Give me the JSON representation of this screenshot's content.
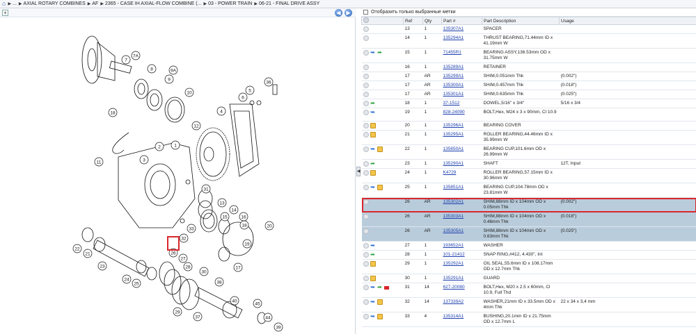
{
  "breadcrumb": {
    "home_icon": "home-icon",
    "items": [
      "...",
      "AXIAL ROTARY COMBINES",
      "AF",
      "2365 - CASE IH AXIAL-FLOW COMBINE (...",
      "03 - POWER TRAIN",
      "06-21 - FINAL DRIVE ASSY"
    ]
  },
  "filter": {
    "label": "Отобразить только выбранные метки",
    "checked": false
  },
  "columns": [
    "",
    "Ref",
    "Qty",
    "Part #",
    "Part Description",
    "Usage"
  ],
  "rows": [
    {
      "ref": "13",
      "qty": "1",
      "part": "135307A1",
      "desc": "SPACER",
      "usage": "",
      "icons": [
        "circle"
      ],
      "state": ""
    },
    {
      "ref": "14",
      "qty": "1",
      "part": "135294A1",
      "desc": "THRUST BEARING,71.44mm ID x 41.19mm W",
      "usage": "",
      "icons": [
        "circle"
      ],
      "state": ""
    },
    {
      "ref": "15",
      "qty": "1",
      "part": "71455R1",
      "desc": "BEARING ASSY,136.53mm OD x 31.75mm W",
      "usage": "",
      "icons": [
        "circle",
        "blue",
        "green"
      ],
      "state": ""
    },
    {
      "ref": "16",
      "qty": "1",
      "part": "135289A1",
      "desc": "RETAINER",
      "usage": "",
      "icons": [
        "circle"
      ],
      "state": ""
    },
    {
      "ref": "17",
      "qty": "AR",
      "part": "135299A1",
      "desc": "SHIM,0.051mm Thk",
      "usage": "(0.002\")",
      "icons": [
        "circle"
      ],
      "state": ""
    },
    {
      "ref": "17",
      "qty": "AR",
      "part": "135300A1",
      "desc": "SHIM,0.457mm Thk",
      "usage": "(0.018\")",
      "icons": [
        "circle"
      ],
      "state": ""
    },
    {
      "ref": "17",
      "qty": "AR",
      "part": "135301A1",
      "desc": "SHIM,0.635mm Thk",
      "usage": "(0.025\")",
      "icons": [
        "circle"
      ],
      "state": ""
    },
    {
      "ref": "18",
      "qty": "1",
      "part": "37-1512",
      "desc": "DOWEL,5/16\" x 3/4\"",
      "usage": "5/16 x 3/4",
      "icons": [
        "circle",
        "green"
      ],
      "state": ""
    },
    {
      "ref": "19",
      "qty": "1",
      "part": "828-24090",
      "desc": "BOLT,Hex, M24 x 3 x 90mm, Cl 10.9",
      "usage": "",
      "icons": [
        "circle",
        "blue"
      ],
      "state": ""
    },
    {
      "ref": "20",
      "qty": "1",
      "part": "135296A1",
      "desc": "BEARING COVER",
      "usage": "",
      "icons": [
        "circle",
        "box"
      ],
      "state": ""
    },
    {
      "ref": "21",
      "qty": "1",
      "part": "135295A1",
      "desc": "ROLLER BEARING,44.46mm ID x 35.99mm W",
      "usage": "",
      "icons": [
        "circle",
        "box"
      ],
      "state": ""
    },
    {
      "ref": "22",
      "qty": "1",
      "part": "135650A1",
      "desc": "BEARING CUP,101.6mm OD x 26.99mm W",
      "usage": "",
      "icons": [
        "circle",
        "blue",
        "box"
      ],
      "state": ""
    },
    {
      "ref": "23",
      "qty": "1",
      "part": "135290A1",
      "desc": "SHAFT",
      "usage": "12T, Input",
      "icons": [
        "circle",
        "green"
      ],
      "state": ""
    },
    {
      "ref": "24",
      "qty": "1",
      "part": "K4729",
      "desc": "ROLLER BEARING,57.15mm ID x 30.96mm W",
      "usage": "",
      "icons": [
        "circle",
        "box"
      ],
      "state": ""
    },
    {
      "ref": "25",
      "qty": "1",
      "part": "135851A1",
      "desc": "BEARING CUP,104.78mm OD x 23.81mm W",
      "usage": "",
      "icons": [
        "circle",
        "blue",
        "box"
      ],
      "state": ""
    },
    {
      "ref": "26",
      "qty": "AR",
      "part": "135302A1",
      "desc": "SHIM,88mm ID x 104mm OD x 0.05mm Thk",
      "usage": "(0.002\")",
      "icons": [
        "circle"
      ],
      "state": "highlight"
    },
    {
      "ref": "26",
      "qty": "AR",
      "part": "135303A1",
      "desc": "SHIM,88mm ID x 104mm OD x 0.46mm Thk",
      "usage": "(0.018\")",
      "icons": [
        "circle"
      ],
      "state": "selected"
    },
    {
      "ref": "26",
      "qty": "AR",
      "part": "135305A1",
      "desc": "SHIM,88mm ID x 104mm OD x 0.63mm Thk",
      "usage": "(0.025\")",
      "icons": [
        "circle"
      ],
      "state": "selected"
    },
    {
      "ref": "27",
      "qty": "1",
      "part": "193652A1",
      "desc": "WASHER",
      "usage": "",
      "icons": [
        "circle",
        "blue"
      ],
      "state": ""
    },
    {
      "ref": "28",
      "qty": "1",
      "part": "101-21412",
      "desc": "SNAP RING,#412, 4.430\", Int",
      "usage": "",
      "icons": [
        "circle",
        "green"
      ],
      "state": ""
    },
    {
      "ref": "29",
      "qty": "1",
      "part": "135292A1",
      "desc": "OIL SEAL,55.6mm ID x 108.17mm OD x 12.7mm Thk",
      "usage": "",
      "icons": [
        "circle",
        "box"
      ],
      "state": ""
    },
    {
      "ref": "30",
      "qty": "1",
      "part": "135291A1",
      "desc": "GUARD",
      "usage": "",
      "icons": [
        "circle",
        "box"
      ],
      "state": ""
    },
    {
      "ref": "31",
      "qty": "14",
      "part": "627-20080",
      "desc": "BOLT,Hex, M20 x 2.5 x 60mm, Cl 10.9, Full Thd",
      "usage": "",
      "icons": [
        "circle",
        "blue",
        "green",
        "flag"
      ],
      "state": ""
    },
    {
      "ref": "32",
      "qty": "14",
      "part": "137339A2",
      "desc": "WASHER,21mm ID x 33.5mm OD x 4mm Thk",
      "usage": "22 x 34 x 3,4 mm",
      "icons": [
        "circle",
        "blue",
        "box"
      ],
      "state": ""
    },
    {
      "ref": "33",
      "qty": "4",
      "part": "135314A1",
      "desc": "BUSHING,20.1mm ID x 21.75mm OD x 12.7mm L",
      "usage": "",
      "icons": [
        "circle",
        "blue",
        "box"
      ],
      "state": ""
    }
  ],
  "diagram_labels": [
    "7",
    "7A",
    "8",
    "9A",
    "9",
    "10",
    "11",
    "12",
    "13",
    "14",
    "15",
    "16",
    "17",
    "18",
    "19",
    "20",
    "21",
    "22",
    "23",
    "24",
    "25",
    "26",
    "27",
    "28",
    "29",
    "30",
    "31",
    "32",
    "33",
    "34",
    "35",
    "36",
    "37",
    "38",
    "39",
    "40",
    "41",
    "42",
    "43",
    "44",
    "45",
    "1",
    "2",
    "3",
    "4",
    "5",
    "6"
  ]
}
